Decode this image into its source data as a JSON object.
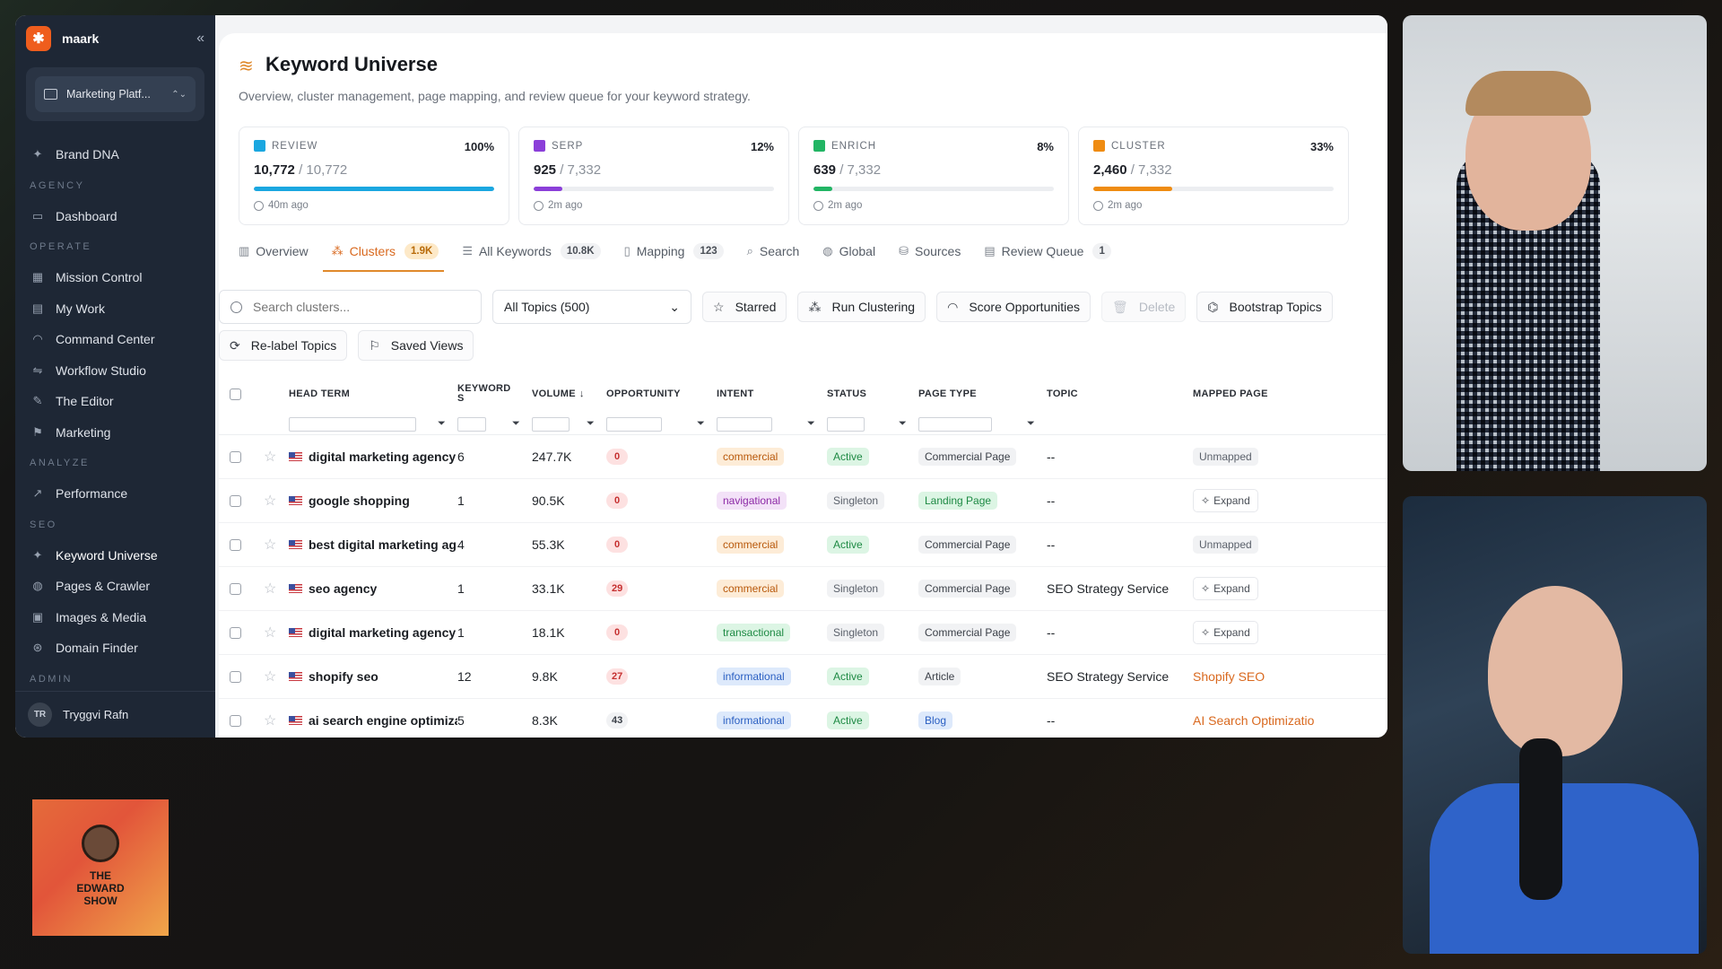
{
  "brand": {
    "name": "maark"
  },
  "workspace": {
    "label": "Marketing Platf..."
  },
  "sidebar": {
    "top_items": [
      {
        "label": "Brand DNA"
      }
    ],
    "sections": [
      {
        "title": "AGENCY",
        "items": [
          {
            "label": "Dashboard"
          }
        ]
      },
      {
        "title": "OPERATE",
        "items": [
          {
            "label": "Mission Control"
          },
          {
            "label": "My Work"
          },
          {
            "label": "Command Center"
          },
          {
            "label": "Workflow Studio"
          },
          {
            "label": "The Editor"
          },
          {
            "label": "Marketing"
          }
        ]
      },
      {
        "title": "ANALYZE",
        "items": [
          {
            "label": "Performance"
          }
        ]
      },
      {
        "title": "SEO",
        "items": [
          {
            "label": "Keyword Universe"
          },
          {
            "label": "Pages & Crawler"
          },
          {
            "label": "Images & Media"
          },
          {
            "label": "Domain Finder"
          }
        ]
      },
      {
        "title": "ADMIN",
        "items": []
      }
    ],
    "user": {
      "initials": "TR",
      "name": "Tryggvi Rafn"
    }
  },
  "page": {
    "title": "Keyword Universe",
    "subtitle": "Overview, cluster management, page mapping, and review queue for your keyword strategy."
  },
  "stats": [
    {
      "label": "REVIEW",
      "pct": "100%",
      "value": "10,772",
      "total": "/ 10,772",
      "ago": "40m ago",
      "color": "#1ba7e0",
      "fill": 1.0
    },
    {
      "label": "SERP",
      "pct": "12%",
      "value": "925",
      "total": "/ 7,332",
      "ago": "2m ago",
      "color": "#8b3fd9",
      "fill": 0.12
    },
    {
      "label": "ENRICH",
      "pct": "8%",
      "value": "639",
      "total": "/ 7,332",
      "ago": "2m ago",
      "color": "#22b564",
      "fill": 0.08
    },
    {
      "label": "CLUSTER",
      "pct": "33%",
      "value": "2,460",
      "total": "/ 7,332",
      "ago": "2m ago",
      "color": "#ef8c12",
      "fill": 0.33
    }
  ],
  "tabs": [
    {
      "label": "Overview",
      "badge": "",
      "icon": "bar-chart-icon"
    },
    {
      "label": "Clusters",
      "badge": "1.9K",
      "icon": "cluster-icon"
    },
    {
      "label": "All Keywords",
      "badge": "10.8K",
      "icon": "list-icon"
    },
    {
      "label": "Mapping",
      "badge": "123",
      "icon": "map-icon"
    },
    {
      "label": "Search",
      "badge": "",
      "icon": "search-icon"
    },
    {
      "label": "Global",
      "badge": "",
      "icon": "globe-icon"
    },
    {
      "label": "Sources",
      "badge": "",
      "icon": "sources-icon"
    },
    {
      "label": "Review Queue",
      "badge": "1",
      "icon": "review-icon"
    }
  ],
  "toolbar": {
    "search_placeholder": "Search clusters...",
    "topic_select": "All Topics (500)",
    "starred": "Starred",
    "run_clustering": "Run Clustering",
    "score_opportunities": "Score Opportunities",
    "delete": "Delete",
    "bootstrap_topics": "Bootstrap Topics",
    "relabel_topics": "Re-label Topics",
    "saved_views": "Saved Views"
  },
  "table": {
    "columns": {
      "head_term": "HEAD TERM",
      "keywords": "KEYWORD S",
      "volume": "VOLUME",
      "opportunity": "OPPORTUNITY",
      "intent": "INTENT",
      "status": "STATUS",
      "page_type": "PAGE TYPE",
      "topic": "TOPIC",
      "mapped_page": "MAPPED PAGE"
    },
    "rows": [
      {
        "term": "digital marketing agency",
        "keywords": "6",
        "volume": "247.7K",
        "opp": "0",
        "intent": "commercial",
        "status": "Active",
        "page_type": "Commercial Page",
        "topic": "--",
        "mapped": "Unmapped",
        "mapped_kind": "unmapped"
      },
      {
        "term": "google shopping",
        "keywords": "1",
        "volume": "90.5K",
        "opp": "0",
        "intent": "navigational",
        "status": "Singleton",
        "page_type": "Landing Page",
        "topic": "--",
        "mapped": "Expand",
        "mapped_kind": "expand"
      },
      {
        "term": "best digital marketing ag",
        "keywords": "4",
        "volume": "55.3K",
        "opp": "0",
        "intent": "commercial",
        "status": "Active",
        "page_type": "Commercial Page",
        "topic": "--",
        "mapped": "Unmapped",
        "mapped_kind": "unmapped"
      },
      {
        "term": "seo agency",
        "keywords": "1",
        "volume": "33.1K",
        "opp": "29",
        "intent": "commercial",
        "status": "Singleton",
        "page_type": "Commercial Page",
        "topic": "SEO Strategy Service",
        "mapped": "Expand",
        "mapped_kind": "expand"
      },
      {
        "term": "digital marketing agency",
        "keywords": "1",
        "volume": "18.1K",
        "opp": "0",
        "intent": "transactional",
        "status": "Singleton",
        "page_type": "Commercial Page",
        "topic": "--",
        "mapped": "Expand",
        "mapped_kind": "expand"
      },
      {
        "term": "shopify seo",
        "keywords": "12",
        "volume": "9.8K",
        "opp": "27",
        "intent": "informational",
        "status": "Active",
        "page_type": "Article",
        "topic": "SEO Strategy Service",
        "mapped": "Shopify SEO",
        "mapped_kind": "link"
      },
      {
        "term": "ai search engine optimiza",
        "keywords": "5",
        "volume": "8.3K",
        "opp": "43",
        "intent": "informational",
        "status": "Active",
        "page_type": "Blog",
        "topic": "--",
        "mapped": "AI Search Optimizatio",
        "mapped_kind": "link"
      }
    ]
  },
  "overlay": {
    "show_name_line1": "THE",
    "show_name_line2": "EDWARD",
    "show_name_line3": "SHOW"
  }
}
